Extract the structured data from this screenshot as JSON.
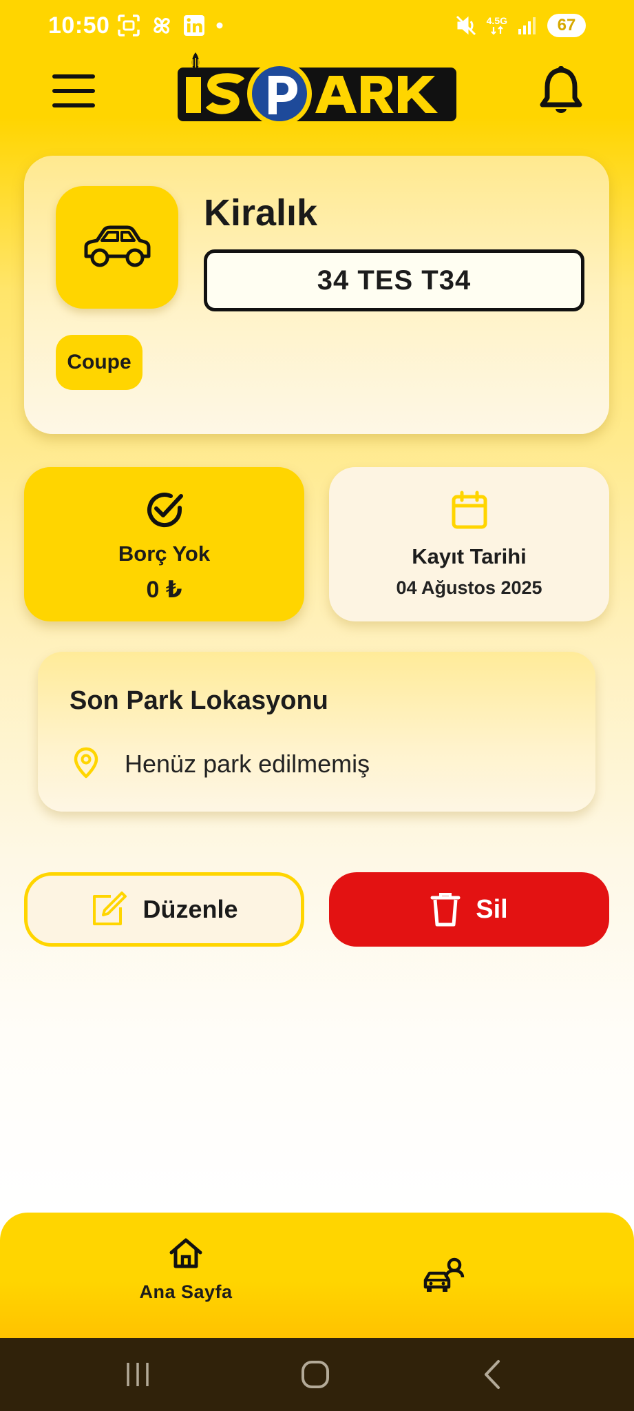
{
  "status_bar": {
    "time": "10:50",
    "network": "4.5G",
    "battery": "67",
    "left_icons": [
      "screenshot-icon",
      "pinwheel-icon",
      "linkedin-icon",
      "dot-icon"
    ],
    "right_icons": [
      "mute-vibrate-icon",
      "network-icon",
      "signal-icon",
      "battery-icon"
    ]
  },
  "header": {
    "logo_text": "İSPARK",
    "menu_icon": "menu-icon",
    "notification_icon": "bell-icon"
  },
  "vehicle": {
    "type": "Kiralık",
    "plate": "34 TES T34",
    "body_style": "Coupe",
    "icon": "car-icon"
  },
  "debt_card": {
    "title": "Borç Yok",
    "amount": "0 ₺",
    "icon": "check-circle-icon"
  },
  "date_card": {
    "title": "Kayıt Tarihi",
    "value": "04 Ağustos 2025",
    "icon": "calendar-icon"
  },
  "location_card": {
    "title": "Son Park Lokasyonu",
    "text": "Henüz park edilmemiş",
    "icon": "location-pin-icon"
  },
  "actions": {
    "edit_label": "Düzenle",
    "delete_label": "Sil"
  },
  "bottom_nav": {
    "home_label": "Ana Sayfa",
    "items": [
      "home-icon",
      "vehicle-person-icon"
    ]
  },
  "colors": {
    "brand_yellow": "#FFD500",
    "delete_red": "#E31212",
    "text_dark": "#1c1c1c",
    "logo_blue": "#1E4A9A"
  }
}
